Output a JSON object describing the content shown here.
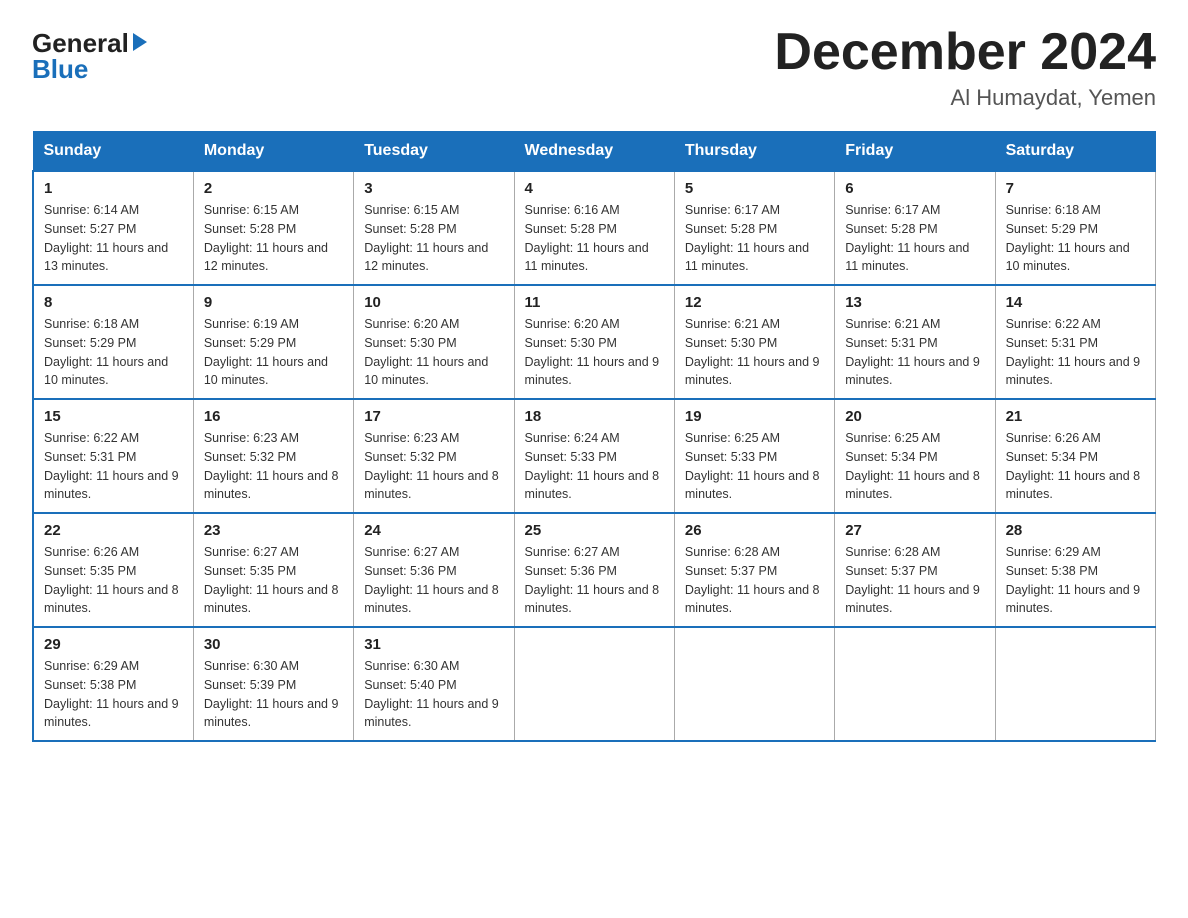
{
  "logo": {
    "general": "General",
    "blue": "Blue"
  },
  "title": "December 2024",
  "location": "Al Humaydat, Yemen",
  "days_of_week": [
    "Sunday",
    "Monday",
    "Tuesday",
    "Wednesday",
    "Thursday",
    "Friday",
    "Saturday"
  ],
  "weeks": [
    [
      {
        "num": "1",
        "sunrise": "6:14 AM",
        "sunset": "5:27 PM",
        "daylight": "11 hours and 13 minutes."
      },
      {
        "num": "2",
        "sunrise": "6:15 AM",
        "sunset": "5:28 PM",
        "daylight": "11 hours and 12 minutes."
      },
      {
        "num": "3",
        "sunrise": "6:15 AM",
        "sunset": "5:28 PM",
        "daylight": "11 hours and 12 minutes."
      },
      {
        "num": "4",
        "sunrise": "6:16 AM",
        "sunset": "5:28 PM",
        "daylight": "11 hours and 11 minutes."
      },
      {
        "num": "5",
        "sunrise": "6:17 AM",
        "sunset": "5:28 PM",
        "daylight": "11 hours and 11 minutes."
      },
      {
        "num": "6",
        "sunrise": "6:17 AM",
        "sunset": "5:28 PM",
        "daylight": "11 hours and 11 minutes."
      },
      {
        "num": "7",
        "sunrise": "6:18 AM",
        "sunset": "5:29 PM",
        "daylight": "11 hours and 10 minutes."
      }
    ],
    [
      {
        "num": "8",
        "sunrise": "6:18 AM",
        "sunset": "5:29 PM",
        "daylight": "11 hours and 10 minutes."
      },
      {
        "num": "9",
        "sunrise": "6:19 AM",
        "sunset": "5:29 PM",
        "daylight": "11 hours and 10 minutes."
      },
      {
        "num": "10",
        "sunrise": "6:20 AM",
        "sunset": "5:30 PM",
        "daylight": "11 hours and 10 minutes."
      },
      {
        "num": "11",
        "sunrise": "6:20 AM",
        "sunset": "5:30 PM",
        "daylight": "11 hours and 9 minutes."
      },
      {
        "num": "12",
        "sunrise": "6:21 AM",
        "sunset": "5:30 PM",
        "daylight": "11 hours and 9 minutes."
      },
      {
        "num": "13",
        "sunrise": "6:21 AM",
        "sunset": "5:31 PM",
        "daylight": "11 hours and 9 minutes."
      },
      {
        "num": "14",
        "sunrise": "6:22 AM",
        "sunset": "5:31 PM",
        "daylight": "11 hours and 9 minutes."
      }
    ],
    [
      {
        "num": "15",
        "sunrise": "6:22 AM",
        "sunset": "5:31 PM",
        "daylight": "11 hours and 9 minutes."
      },
      {
        "num": "16",
        "sunrise": "6:23 AM",
        "sunset": "5:32 PM",
        "daylight": "11 hours and 8 minutes."
      },
      {
        "num": "17",
        "sunrise": "6:23 AM",
        "sunset": "5:32 PM",
        "daylight": "11 hours and 8 minutes."
      },
      {
        "num": "18",
        "sunrise": "6:24 AM",
        "sunset": "5:33 PM",
        "daylight": "11 hours and 8 minutes."
      },
      {
        "num": "19",
        "sunrise": "6:25 AM",
        "sunset": "5:33 PM",
        "daylight": "11 hours and 8 minutes."
      },
      {
        "num": "20",
        "sunrise": "6:25 AM",
        "sunset": "5:34 PM",
        "daylight": "11 hours and 8 minutes."
      },
      {
        "num": "21",
        "sunrise": "6:26 AM",
        "sunset": "5:34 PM",
        "daylight": "11 hours and 8 minutes."
      }
    ],
    [
      {
        "num": "22",
        "sunrise": "6:26 AM",
        "sunset": "5:35 PM",
        "daylight": "11 hours and 8 minutes."
      },
      {
        "num": "23",
        "sunrise": "6:27 AM",
        "sunset": "5:35 PM",
        "daylight": "11 hours and 8 minutes."
      },
      {
        "num": "24",
        "sunrise": "6:27 AM",
        "sunset": "5:36 PM",
        "daylight": "11 hours and 8 minutes."
      },
      {
        "num": "25",
        "sunrise": "6:27 AM",
        "sunset": "5:36 PM",
        "daylight": "11 hours and 8 minutes."
      },
      {
        "num": "26",
        "sunrise": "6:28 AM",
        "sunset": "5:37 PM",
        "daylight": "11 hours and 8 minutes."
      },
      {
        "num": "27",
        "sunrise": "6:28 AM",
        "sunset": "5:37 PM",
        "daylight": "11 hours and 9 minutes."
      },
      {
        "num": "28",
        "sunrise": "6:29 AM",
        "sunset": "5:38 PM",
        "daylight": "11 hours and 9 minutes."
      }
    ],
    [
      {
        "num": "29",
        "sunrise": "6:29 AM",
        "sunset": "5:38 PM",
        "daylight": "11 hours and 9 minutes."
      },
      {
        "num": "30",
        "sunrise": "6:30 AM",
        "sunset": "5:39 PM",
        "daylight": "11 hours and 9 minutes."
      },
      {
        "num": "31",
        "sunrise": "6:30 AM",
        "sunset": "5:40 PM",
        "daylight": "11 hours and 9 minutes."
      },
      null,
      null,
      null,
      null
    ]
  ],
  "labels": {
    "sunrise": "Sunrise:",
    "sunset": "Sunset:",
    "daylight": "Daylight:"
  },
  "colors": {
    "header_bg": "#1a6fba",
    "header_text": "#ffffff",
    "border": "#aaa",
    "body_text": "#222"
  }
}
